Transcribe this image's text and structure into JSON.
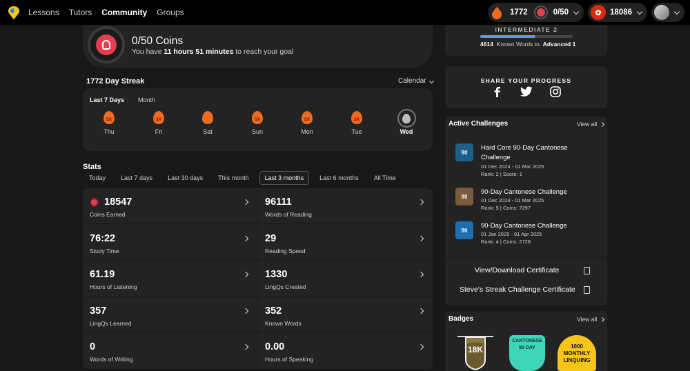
{
  "nav": {
    "items": [
      "Lessons",
      "Tutors",
      "Community",
      "Groups"
    ],
    "active": "Community"
  },
  "header": {
    "streak_count": "1772",
    "coins_progress": "0/50",
    "known_words": "18086"
  },
  "coins": {
    "title": "0/50 Coins",
    "sub_pre": "You have",
    "sub_time": "11 hours 51 minutes",
    "sub_post": "to reach your goal"
  },
  "streak": {
    "title": "1772 Day Streak",
    "calendar_label": "Calendar",
    "tabs": [
      "Last 7 Days",
      "Month"
    ],
    "days": [
      {
        "label": "Thu",
        "mult": "5X"
      },
      {
        "label": "Fri",
        "mult": "3X"
      },
      {
        "label": "Sat",
        "mult": ""
      },
      {
        "label": "Sun",
        "mult": "5X"
      },
      {
        "label": "Mon",
        "mult": "5X"
      },
      {
        "label": "Tue",
        "mult": "3X"
      },
      {
        "label": "Wed",
        "mult": ""
      }
    ]
  },
  "stats": {
    "title": "Stats",
    "filters": [
      "Today",
      "Last 7 days",
      "Last 30 days",
      "This month",
      "Last 3 months",
      "Last 6 months",
      "All Time"
    ],
    "active_filter": "Last 3 months",
    "items": [
      {
        "value": "18547",
        "label": "Coins Earned"
      },
      {
        "value": "96111",
        "label": "Words of Reading"
      },
      {
        "value": "76:22",
        "label": "Study Time"
      },
      {
        "value": "29",
        "label": "Reading Speed"
      },
      {
        "value": "61.19",
        "label": "Hours of Listening"
      },
      {
        "value": "1330",
        "label": "LingQs Created"
      },
      {
        "value": "357",
        "label": "LingQs Learned"
      },
      {
        "value": "352",
        "label": "Known Words"
      },
      {
        "value": "0",
        "label": "Words of Writing"
      },
      {
        "value": "0.00",
        "label": "Hours of Speaking"
      }
    ]
  },
  "level": {
    "title": "INTERMEDIATE 2",
    "progress": 0.6,
    "count": "4614",
    "sub_mid": "Known Words to",
    "next_level": "Advanced 1"
  },
  "share": {
    "title": "SHARE YOUR PROGRESS",
    "icons": [
      "facebook-icon",
      "twitter-icon",
      "instagram-icon"
    ]
  },
  "challenges": {
    "title": "Active Challenges",
    "view_all": "View all",
    "items": [
      {
        "name": "Hard Core 90-Day Cantonese Challenge",
        "dates": "01 Dec 2024 - 01 Mar 2025",
        "meta": "Rank: 2  |  Score: 1",
        "badge_text": "90",
        "color": "#1c5f8a"
      },
      {
        "name": "90-Day Cantonese Challenge",
        "dates": "01 Dec 2024 - 01 Mar 2025",
        "meta": "Rank: 5  |  Coins: 7297",
        "badge_text": "90",
        "color": "#7a5a3a"
      },
      {
        "name": "90-Day Cantonese Challenge",
        "dates": "01 Jan 2025 - 01 Apr 2025",
        "meta": "Rank: 4  |  Coins: 2728",
        "badge_text": "90",
        "color": "#1c6fb0"
      }
    ]
  },
  "certificates": {
    "download": "View/Download Certificate",
    "streak": "Steve's Streak Challenge Certificate"
  },
  "badges": {
    "title": "Badges",
    "view_all": "View all",
    "items": [
      {
        "text": "18K",
        "color": "#6b5a2e"
      },
      {
        "text": "CANTONESE 90 DAY",
        "color": "#3dd6b8"
      },
      {
        "text": "1000 MONTHLY LINQUING",
        "color": "#f5c518"
      }
    ]
  }
}
